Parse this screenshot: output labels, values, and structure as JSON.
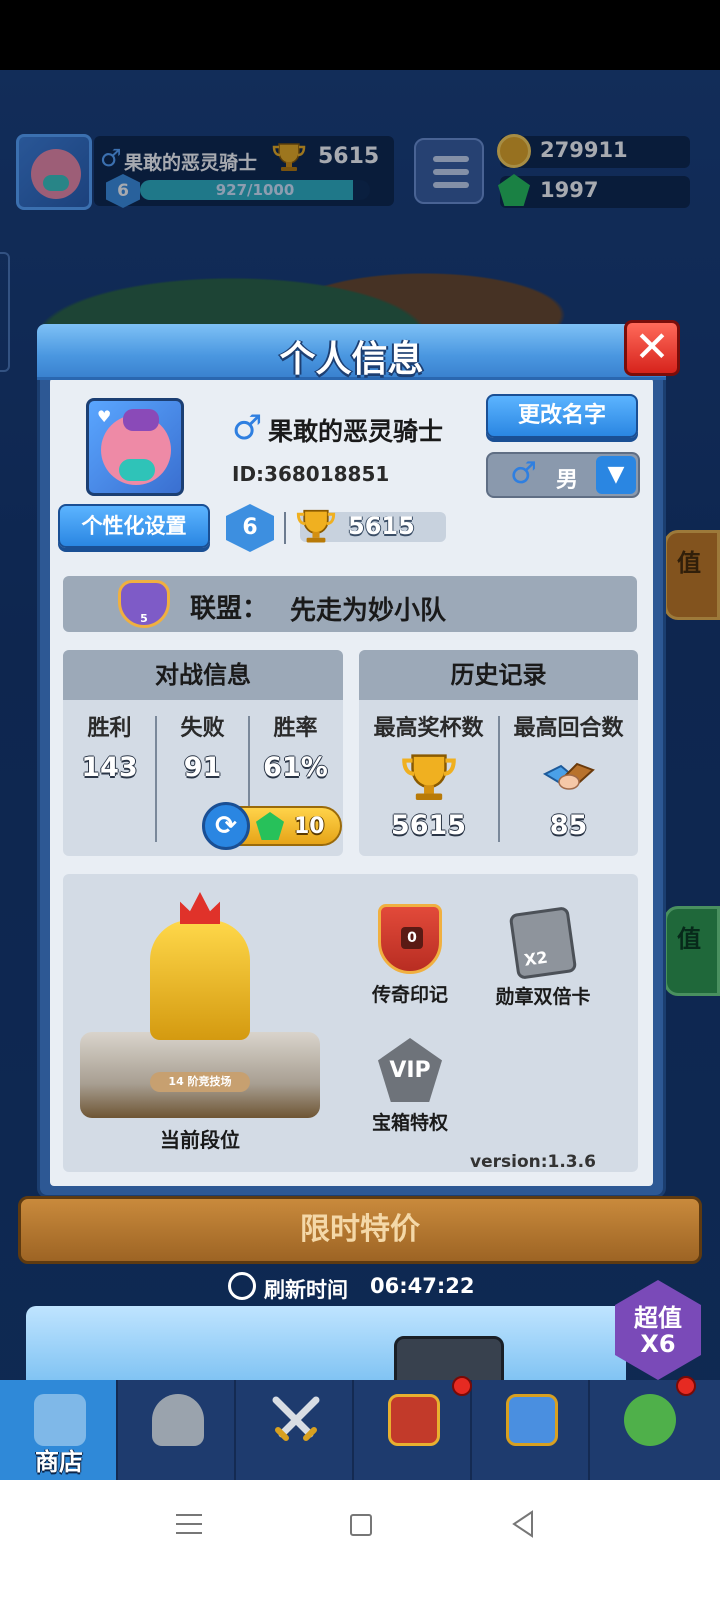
{
  "hud": {
    "player_name": "果敢的恶灵骑士",
    "trophies": "5615",
    "level": "6",
    "xp_text": "927/1000",
    "xp_fraction": 0.927,
    "coins": "279911",
    "gems": "1997",
    "gender_icon": "male-icon"
  },
  "panel": {
    "title": "个人信息",
    "name": "果敢的恶灵骑士",
    "id_text": "ID:368018851",
    "rename_label": "更改名字",
    "custom_label": "个性化设置",
    "gender_value": "男",
    "level": "6",
    "trophies": "5615",
    "alliance_label": "联盟：",
    "alliance_name": "先走为妙小队",
    "alliance_level": "5"
  },
  "battle": {
    "title": "对战信息",
    "stats": [
      {
        "label": "胜利",
        "value": "143"
      },
      {
        "label": "失败",
        "value": "91"
      },
      {
        "label": "胜率",
        "value": "61%"
      }
    ],
    "reset_cost": "10"
  },
  "history": {
    "title": "历史记录",
    "items": [
      {
        "label": "最高奖杯数",
        "value": "5615",
        "icon": "trophy-icon"
      },
      {
        "label": "最高回合数",
        "value": "85",
        "icon": "handshake-icon"
      }
    ]
  },
  "rank": {
    "label": "当前段位",
    "arena_plate": "14 阶竞技场",
    "features": [
      {
        "label": "传奇印记",
        "icon": "legend-mark-icon",
        "badge": "0"
      },
      {
        "label": "勋章双倍卡",
        "icon": "medal-double-card-icon",
        "badge": "X2"
      },
      {
        "label": "宝箱特权",
        "icon": "vip-chest-icon",
        "badge": "VIP"
      }
    ],
    "version": "version:1.3.6"
  },
  "shop": {
    "sale_label": "限时特价",
    "refresh_label": "刷新时间",
    "refresh_time": "06:47:22",
    "super_top": "超值",
    "super_bottom": "X6"
  },
  "side_tabs": [
    "值",
    "值"
  ],
  "tabs": [
    {
      "label": "商店",
      "icon": "shop-chest-icon",
      "active": true
    },
    {
      "label": "",
      "icon": "knight-helmet-icon",
      "active": false
    },
    {
      "label": "",
      "icon": "crossed-swords-icon",
      "active": false
    },
    {
      "label": "",
      "icon": "crown-shield-icon",
      "active": false,
      "dot": true
    },
    {
      "label": "",
      "icon": "alliance-flag-icon",
      "active": false
    },
    {
      "label": "",
      "icon": "sprout-icon",
      "active": false,
      "dot": true
    }
  ],
  "colors": {
    "accent_blue": "#2a86e2",
    "close_red": "#d6231c",
    "gold": "#e6a418",
    "gem_green": "#27c15a"
  }
}
